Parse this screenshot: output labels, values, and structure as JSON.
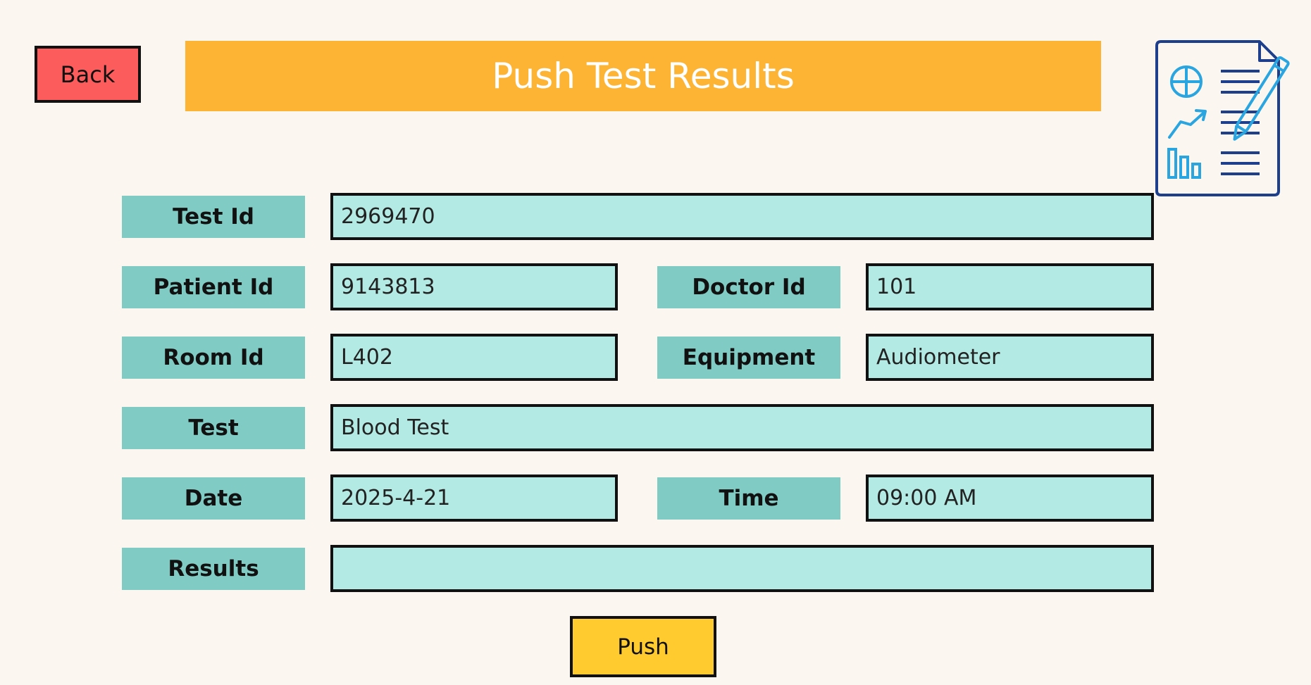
{
  "header": {
    "back_label": "Back",
    "title": "Push Test Results"
  },
  "form": {
    "test_id": {
      "label": "Test Id",
      "value": "2969470"
    },
    "patient_id": {
      "label": "Patient Id",
      "value": "9143813"
    },
    "doctor_id": {
      "label": "Doctor Id",
      "value": "101"
    },
    "room_id": {
      "label": "Room Id",
      "value": "L402"
    },
    "equipment": {
      "label": "Equipment",
      "value": "Audiometer"
    },
    "test": {
      "label": "Test",
      "value": "Blood Test"
    },
    "date": {
      "label": "Date",
      "value": "2025-4-21"
    },
    "time": {
      "label": "Time",
      "value": "09:00 AM"
    },
    "results": {
      "label": "Results",
      "value": ""
    }
  },
  "actions": {
    "push_label": "Push"
  },
  "colors": {
    "background": "#fbf7f0",
    "back_button": "#fc5c5c",
    "title_bar": "#fdb434",
    "label_bg": "#80cbc4",
    "field_bg": "#b3ebe4",
    "push_button": "#ffcb2e",
    "icon_dark_blue": "#1e3f8c",
    "icon_light_blue": "#2aa5e0"
  },
  "icons": {
    "header_icon": "medical-report-document-icon"
  }
}
